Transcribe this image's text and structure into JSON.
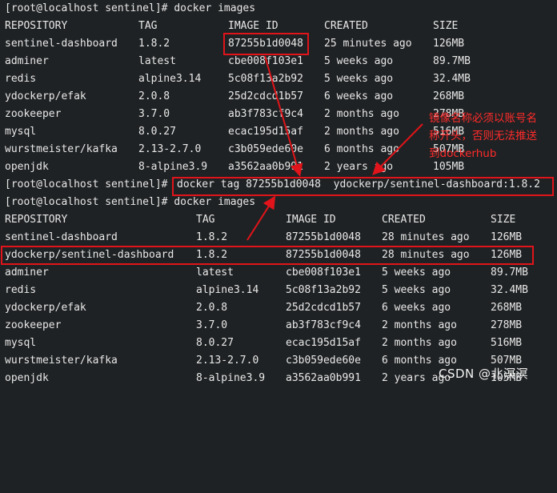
{
  "terminal": {
    "prompt1": "[root@localhost sentinel]# docker images",
    "table1": {
      "headers": [
        "REPOSITORY",
        "TAG",
        "IMAGE ID",
        "CREATED",
        "SIZE"
      ],
      "rows": [
        [
          "sentinel-dashboard",
          "1.8.2",
          "87255b1d0048",
          "25 minutes ago",
          "126MB"
        ],
        [
          "adminer",
          "latest",
          "cbe008f103e1",
          "5 weeks ago",
          "89.7MB"
        ],
        [
          "redis",
          "alpine3.14",
          "5c08f13a2b92",
          "5 weeks ago",
          "32.4MB"
        ],
        [
          "ydockerp/efak",
          "2.0.8",
          "25d2cdcd1b57",
          "6 weeks ago",
          "268MB"
        ],
        [
          "zookeeper",
          "3.7.0",
          "ab3f783cf9c4",
          "2 months ago",
          "278MB"
        ],
        [
          "mysql",
          "8.0.27",
          "ecac195d15af",
          "2 months ago",
          "516MB"
        ],
        [
          "wurstmeister/kafka",
          "2.13-2.7.0",
          "c3b059ede60e",
          "6 months ago",
          "507MB"
        ],
        [
          "openjdk",
          "8-alpine3.9",
          "a3562aa0b991",
          "2 years ago",
          "105MB"
        ]
      ]
    },
    "prompt2_prefix": "[root@localhost sentinel]# ",
    "prompt2_cmd": "docker tag 87255b1d0048  ydockerp/sentinel-dashboard:1.8.2",
    "prompt3": "[root@localhost sentinel]# docker images",
    "table2": {
      "headers": [
        "REPOSITORY",
        "TAG",
        "IMAGE ID",
        "CREATED",
        "SIZE"
      ],
      "rows": [
        [
          "sentinel-dashboard",
          "1.8.2",
          "87255b1d0048",
          "28 minutes ago",
          "126MB"
        ],
        [
          "ydockerp/sentinel-dashboard",
          "1.8.2",
          "87255b1d0048",
          "28 minutes ago",
          "126MB"
        ],
        [
          "adminer",
          "latest",
          "cbe008f103e1",
          "5 weeks ago",
          "89.7MB"
        ],
        [
          "redis",
          "alpine3.14",
          "5c08f13a2b92",
          "5 weeks ago",
          "32.4MB"
        ],
        [
          "ydockerp/efak",
          "2.0.8",
          "25d2cdcd1b57",
          "6 weeks ago",
          "268MB"
        ],
        [
          "zookeeper",
          "3.7.0",
          "ab3f783cf9c4",
          "2 months ago",
          "278MB"
        ],
        [
          "mysql",
          "8.0.27",
          "ecac195d15af",
          "2 months ago",
          "516MB"
        ],
        [
          "wurstmeister/kafka",
          "2.13-2.7.0",
          "c3b059ede60e",
          "6 months ago",
          "507MB"
        ],
        [
          "openjdk",
          "8-alpine3.9",
          "a3562aa0b991",
          "2 years ago",
          "105MB"
        ]
      ]
    }
  },
  "annotation": "镜像名称必须以账号名\n称开头，否则无法推送\n到dockerhub",
  "watermark": "CSDN @北溟溟",
  "colors": {
    "background": "#1f2224",
    "text": "#e8e8e8",
    "highlight": "#e0141a"
  }
}
